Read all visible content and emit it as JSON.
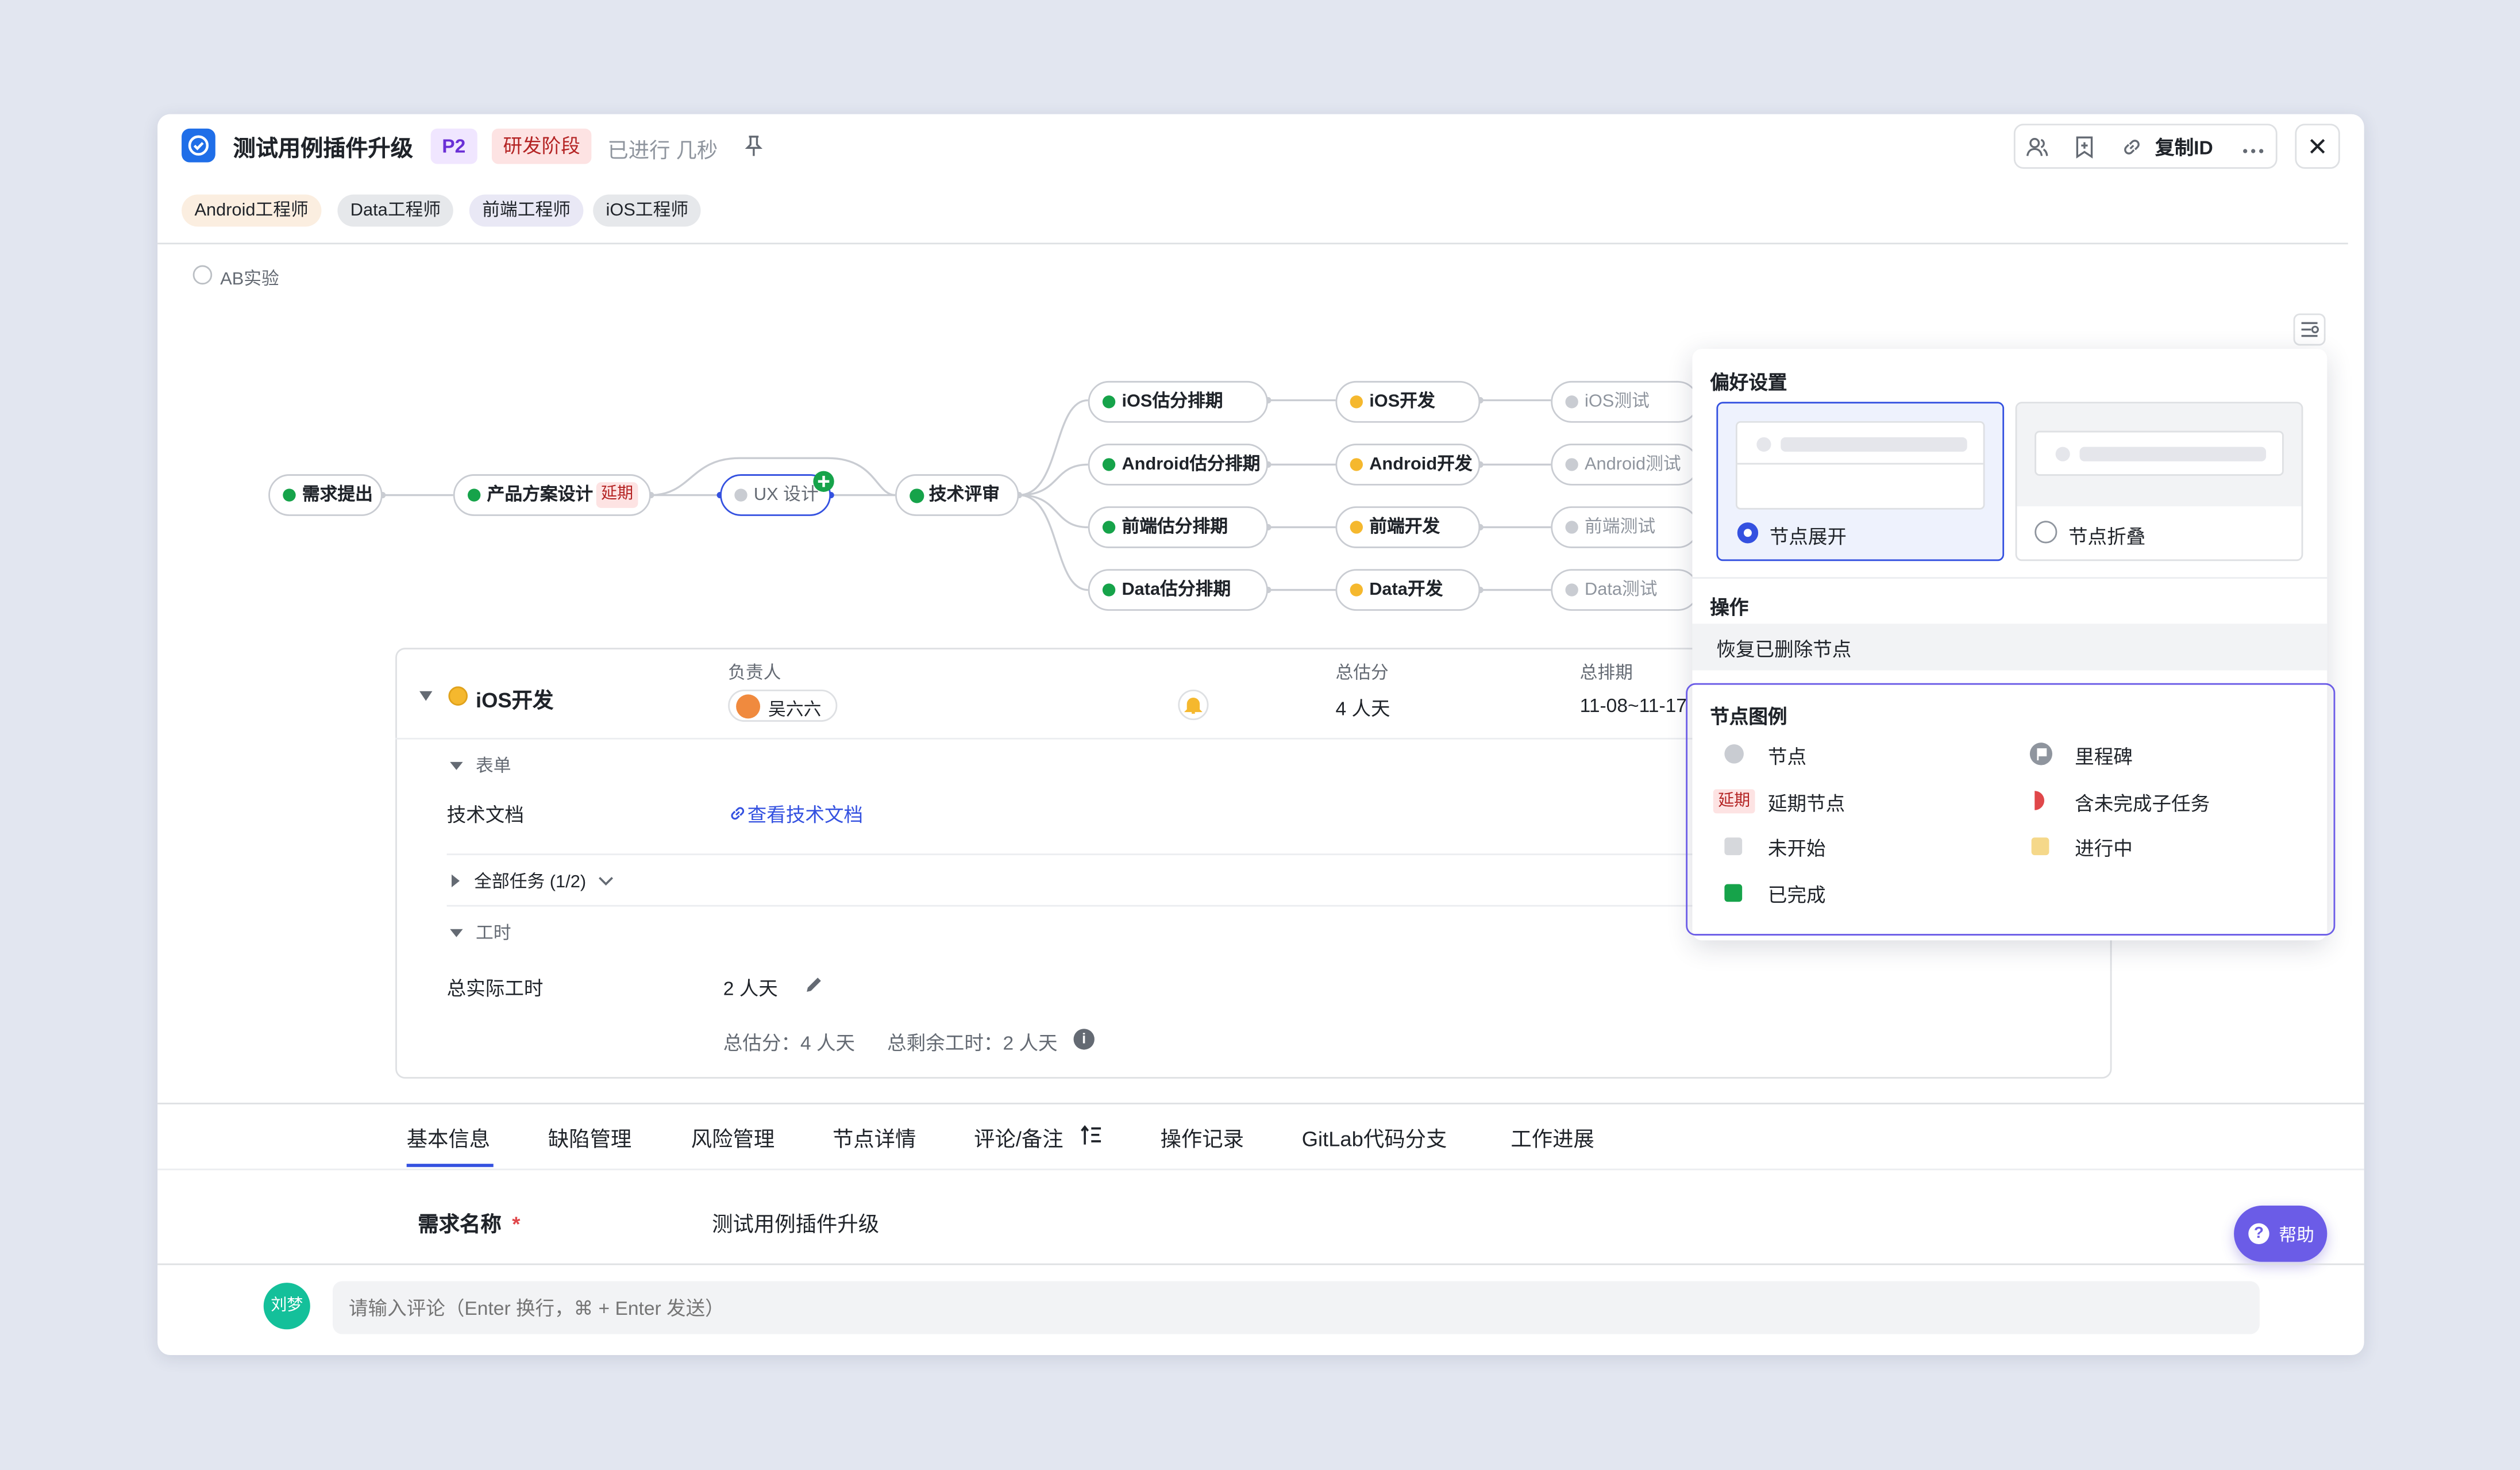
{
  "header": {
    "title": "测试用例插件升级",
    "priority": "P2",
    "stage": "研发阶段",
    "elapsed": "已进行 几秒",
    "copy_id": "复制ID"
  },
  "tags": [
    "Android工程师",
    "Data工程师",
    "前端工程师",
    "iOS工程师"
  ],
  "ab_test_label": "AB实验",
  "flow": {
    "nodes": {
      "req": "需求提出",
      "design": "产品方案设计",
      "delay": "延期",
      "ux": "UX 设计",
      "review": "技术评审",
      "ios_est": "iOS估分排期",
      "and_est": "Android估分排期",
      "fe_est": "前端估分排期",
      "data_est": "Data估分排期",
      "ios_dev": "iOS开发",
      "and_dev": "Android开发",
      "fe_dev": "前端开发",
      "data_dev": "Data开发",
      "ios_test": "iOS测试",
      "and_test": "Android测试",
      "fe_test": "前端测试",
      "data_test": "Data测试"
    }
  },
  "detail": {
    "name": "iOS开发",
    "owner_label": "负责人",
    "owner": "吴六六",
    "estimate_label": "总估分",
    "estimate": "4 人天",
    "schedule_label": "总排期",
    "schedule": "11-08~11-17",
    "form_label": "表单",
    "doc_label": "技术文档",
    "doc_link": "查看技术文档",
    "tasks_label": "全部任务 (1/2)",
    "hours_label": "工时",
    "actual_label": "总实际工时",
    "actual": "2 人天",
    "summary_est": "总估分：4 人天",
    "summary_remain": "总剩余工时：2 人天"
  },
  "tabs": [
    "基本信息",
    "缺陷管理",
    "风险管理",
    "节点详情",
    "评论/备注",
    "操作记录",
    "GitLab代码分支",
    "工作进展"
  ],
  "basic": {
    "name_label": "需求名称",
    "required_mark": "*",
    "name_value": "测试用例插件升级"
  },
  "comment": {
    "avatar": "刘梦",
    "placeholder": "请输入评论（Enter 换行，⌘ + Enter 发送）"
  },
  "help": "帮助",
  "popover": {
    "pref_title": "偏好设置",
    "expand": "节点展开",
    "collapse": "节点折叠",
    "ops_title": "操作",
    "restore": "恢复已删除节点",
    "legend_title": "节点图例",
    "legend": {
      "node": "节点",
      "milestone": "里程碑",
      "delay_tag": "延期",
      "delayed_node": "延期节点",
      "unfinished_sub": "含未完成子任务",
      "not_started": "未开始",
      "in_progress": "进行中",
      "done": "已完成"
    }
  },
  "colors": {
    "primary": "#3451e0",
    "done": "#16a34a",
    "in_progress": "#f5b82e",
    "delay": "#e0474a",
    "help": "#6b5ce7"
  }
}
